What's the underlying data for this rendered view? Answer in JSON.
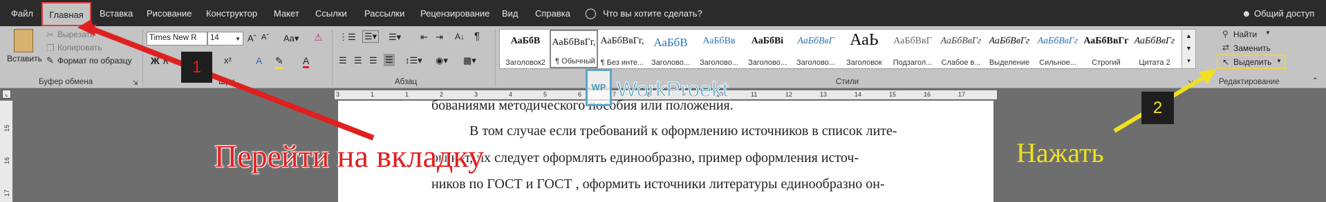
{
  "tabs": {
    "file": "Файл",
    "home": "Главная",
    "insert": "Вставка",
    "draw": "Рисование",
    "design": "Конструктор",
    "layout": "Макет",
    "references": "Ссылки",
    "mailings": "Рассылки",
    "review": "Рецензирование",
    "view": "Вид",
    "help": "Справка",
    "tell_me": "Что вы хотите сделать?",
    "share": "Общий доступ"
  },
  "clipboard": {
    "paste": "Вставить",
    "cut": "Вырезать",
    "copy": "Копировать",
    "format_painter": "Формат по образцу",
    "group": "Буфер обмена"
  },
  "font": {
    "name": "Times New R",
    "size": "14",
    "group": "Шри"
  },
  "paragraph": {
    "group": "Абзац"
  },
  "styles": {
    "group": "Стили",
    "items": [
      {
        "preview": "АаБбВ",
        "name": "Заголовок2"
      },
      {
        "preview": "АаБбВвГг,",
        "name": "¶ Обычный"
      },
      {
        "preview": "АаБбВвГг,",
        "name": "¶ Без инте..."
      },
      {
        "preview": "АаБбВ",
        "name": "Заголово..."
      },
      {
        "preview": "АаБбВв",
        "name": "Заголово..."
      },
      {
        "preview": "АаБбВі",
        "name": "Заголово..."
      },
      {
        "preview": "АаБбВвГ",
        "name": "Заголово..."
      },
      {
        "preview": "АаЬ",
        "name": "Заголовок"
      },
      {
        "preview": "АаБбВвГ",
        "name": "Подзагол..."
      },
      {
        "preview": "АаБбВвГг",
        "name": "Слабое в..."
      },
      {
        "preview": "АаБбВвГг",
        "name": "Выделение"
      },
      {
        "preview": "АаБбВвГг",
        "name": "Сильное..."
      },
      {
        "preview": "АаБбВвГг",
        "name": "Строгий"
      },
      {
        "preview": "АаБбВвГг",
        "name": "Цитата 2"
      }
    ]
  },
  "editing": {
    "find": "Найти",
    "replace": "Заменить",
    "select": "Выделить",
    "group": "Редактирование"
  },
  "ruler": {
    "h": [
      "3",
      "1",
      "1",
      "2",
      "3",
      "4",
      "5",
      "6",
      "7",
      "8",
      "9",
      "10",
      "11",
      "12",
      "13",
      "14",
      "15",
      "16",
      "17"
    ],
    "v": [
      "15",
      "16",
      "17"
    ]
  },
  "document": {
    "lines": [
      "бованиями методического пособия или положения.",
      "В том случае если требований к оформлению источников в список лите-",
      "ры нет, их следует оформлять единообразно, пример оформления источ-",
      "ников по ГОСТ и ГОСТ , оформить источники литературы единообразно он-"
    ]
  },
  "annotations": {
    "goto_tab": "Перейти на вкладку",
    "press": "Нажать",
    "step1": "1",
    "step2": "2",
    "watermark": "WorkProekt"
  },
  "colors": {
    "tab_bar": "#2b2b2b",
    "ribbon": "#c4c4c4",
    "highlight_red": "#e04040",
    "highlight_yellow": "#f0d040",
    "annotation_red": "#e02020",
    "annotation_yellow": "#f0e020"
  }
}
